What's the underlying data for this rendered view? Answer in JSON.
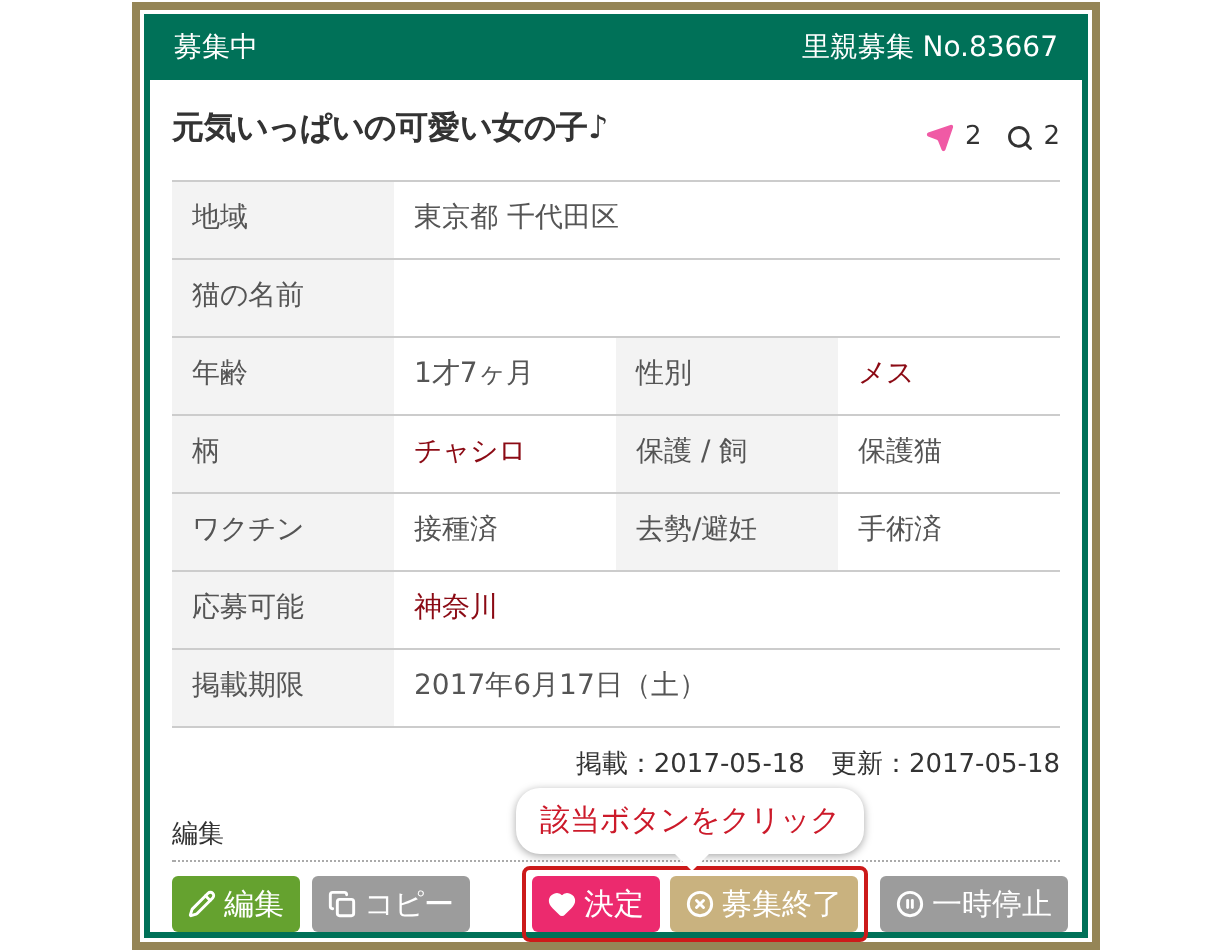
{
  "header": {
    "status": "募集中",
    "number": "里親募集 No.83667"
  },
  "title": "元気いっぱいの可愛い女の子♪",
  "stats": [
    {
      "kind": "send",
      "count": "2"
    },
    {
      "kind": "view",
      "count": "2"
    }
  ],
  "table": {
    "rows": [
      {
        "cells": [
          {
            "label": "地域",
            "value": "東京都 千代田区",
            "emphasis": false
          }
        ]
      },
      {
        "cells": [
          {
            "label": "猫の名前"
          }
        ]
      },
      {
        "cells": [
          {
            "label": "年齢",
            "value": "1才7ヶ月",
            "emphasis": false
          },
          {
            "label": "性別",
            "value": "メス",
            "emphasis": true
          }
        ]
      },
      {
        "cells": [
          {
            "label": "柄",
            "value": "チャシロ",
            "emphasis": true
          },
          {
            "label": "保護 / 飼",
            "value": "保護猫",
            "emphasis": false
          }
        ]
      },
      {
        "cells": [
          {
            "label": "ワクチン",
            "value": "接種済",
            "emphasis": false
          },
          {
            "label": "去勢/避妊",
            "value": "手術済",
            "emphasis": false
          }
        ]
      },
      {
        "cells": [
          {
            "label": "応募可能",
            "value": "神奈川",
            "emphasis": true
          }
        ]
      },
      {
        "cells": [
          {
            "label": "掲載期限",
            "value": "2017年6月17日（土）",
            "emphasis": false
          }
        ]
      }
    ]
  },
  "dates": "掲載：2017-05-18　更新：2017-05-18",
  "edit_section": {
    "label": "編集"
  },
  "buttons": [
    {
      "kind": "edit",
      "label": "編集",
      "highlighted": false
    },
    {
      "kind": "copy",
      "label": "コピー",
      "highlighted": false
    },
    {
      "kind": "decide",
      "label": "決定",
      "highlighted": true
    },
    {
      "kind": "close",
      "label": "募集終了",
      "highlighted": true
    },
    {
      "kind": "pause",
      "label": "一時停止",
      "highlighted": false
    }
  ],
  "callout": {
    "text": "該当ボタンをクリック"
  }
}
